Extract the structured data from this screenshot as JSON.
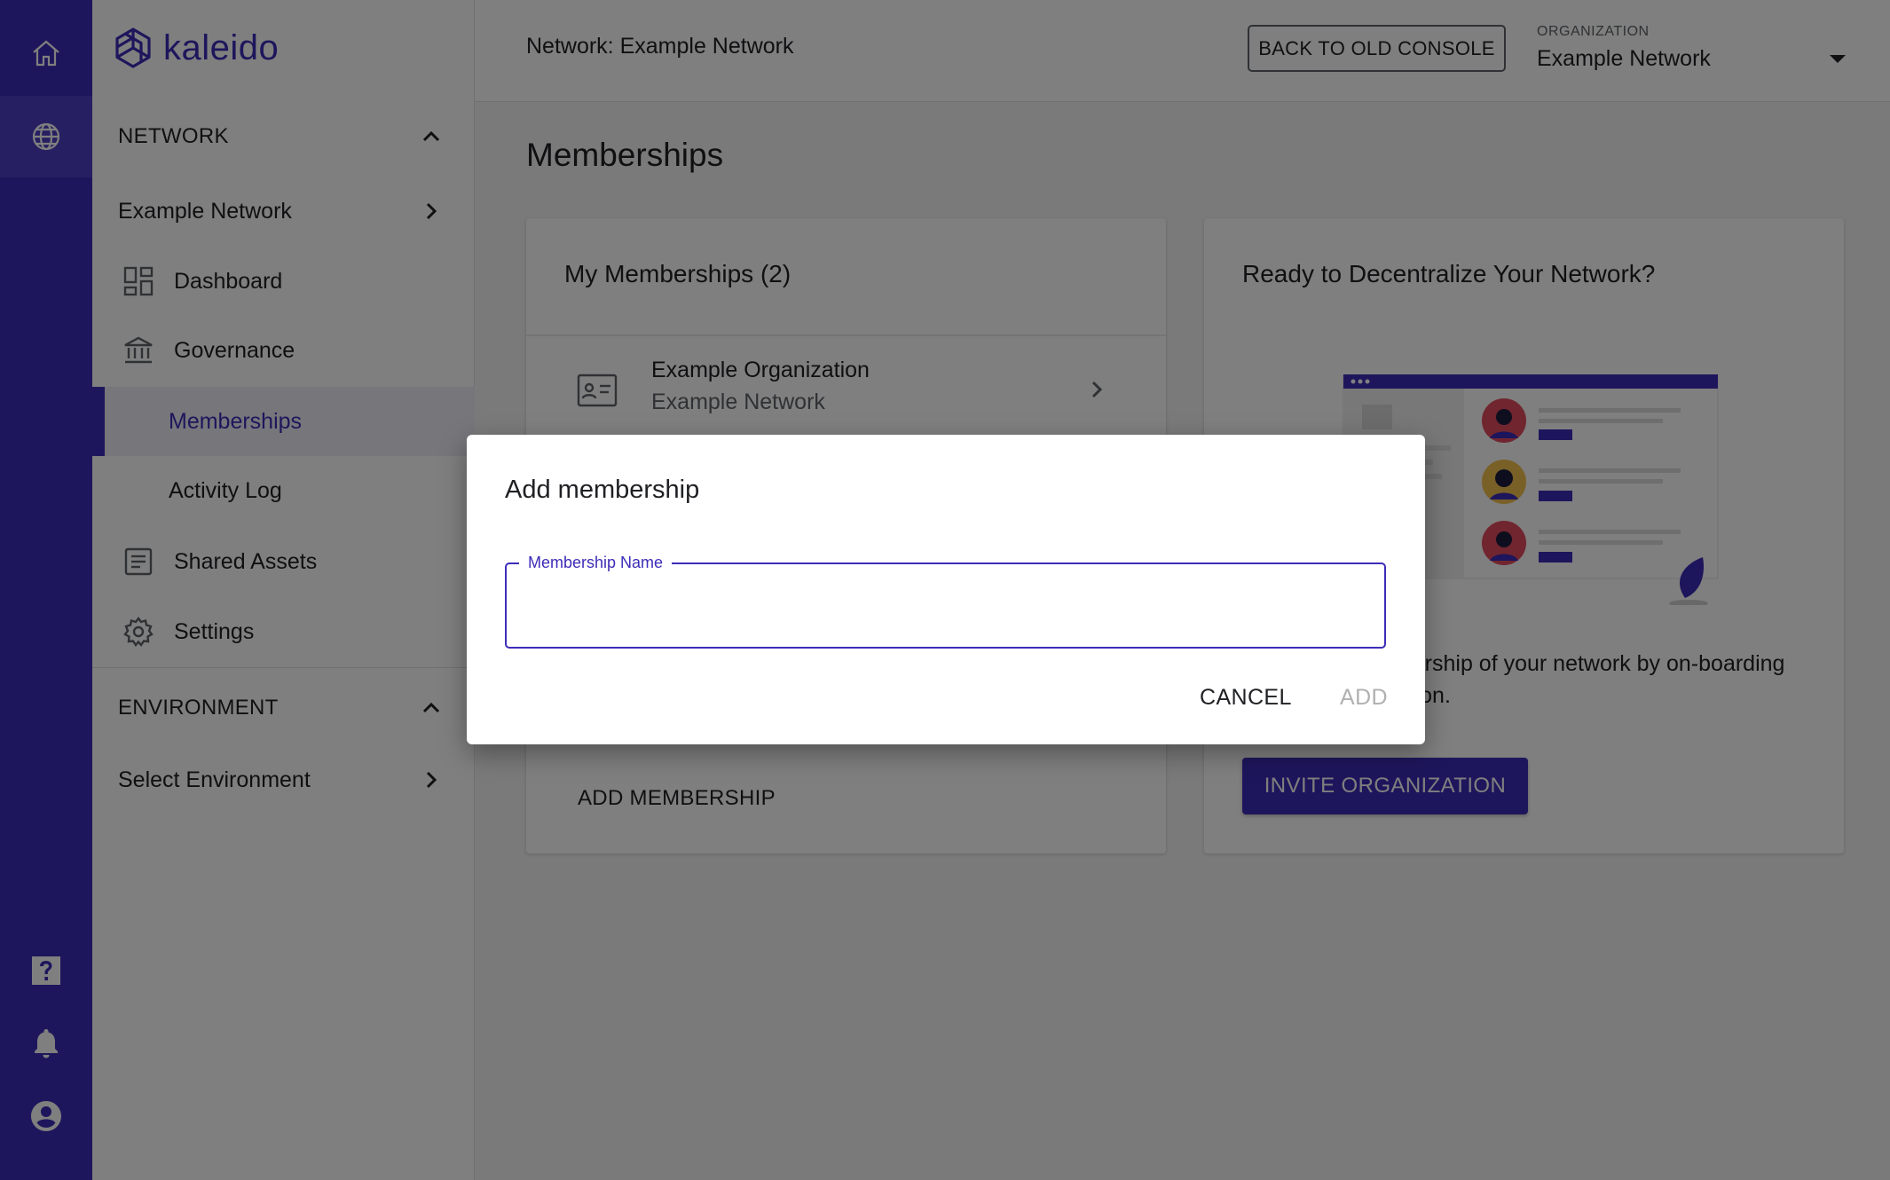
{
  "app": {
    "logo_text": "kaleido",
    "brand_color": "#3c2db8"
  },
  "rail": {
    "top_items": [
      {
        "icon": "home-icon"
      },
      {
        "icon": "globe-icon",
        "active": true
      }
    ],
    "bottom_items": [
      {
        "icon": "help-icon"
      },
      {
        "icon": "bell-icon"
      },
      {
        "icon": "account-icon"
      }
    ]
  },
  "sidebar": {
    "network_section": "NETWORK",
    "network_name": "Example Network",
    "items": [
      {
        "label": "Dashboard",
        "icon": "dashboard-icon"
      },
      {
        "label": "Governance",
        "icon": "bank-icon"
      },
      {
        "label": "Memberships",
        "selected": true
      },
      {
        "label": "Activity Log"
      },
      {
        "label": "Shared Assets",
        "icon": "document-icon"
      },
      {
        "label": "Settings",
        "icon": "gear-icon"
      }
    ],
    "environment_section": "ENVIRONMENT",
    "environment_select": "Select Environment"
  },
  "topbar": {
    "network_label": "Network: Example Network",
    "old_console": "BACK TO OLD CONSOLE",
    "org_caption": "ORGANIZATION",
    "org_value": "Example Network"
  },
  "main": {
    "title": "Memberships",
    "my_memberships": {
      "title": "My Memberships (2)",
      "rows": [
        {
          "name": "Example Organization",
          "network": "Example Network"
        }
      ],
      "add_label": "ADD MEMBERSHIP"
    },
    "decentralize": {
      "title": "Ready to Decentralize Your Network?",
      "description": "Decentralize ownership of your network by on-boarding another organization.",
      "invite_label": "INVITE ORGANIZATION"
    }
  },
  "dialog": {
    "title": "Add membership",
    "field_label": "Membership Name",
    "field_value": "",
    "cancel_label": "CANCEL",
    "add_label": "ADD"
  }
}
